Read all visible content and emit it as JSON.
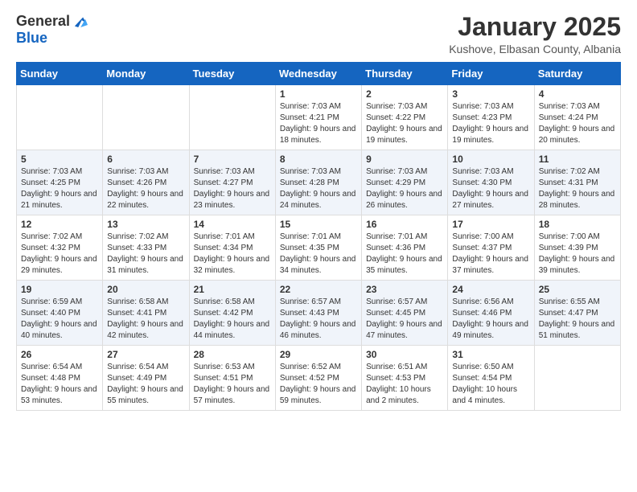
{
  "header": {
    "logo_general": "General",
    "logo_blue": "Blue",
    "month_title": "January 2025",
    "subtitle": "Kushove, Elbasan County, Albania"
  },
  "weekdays": [
    "Sunday",
    "Monday",
    "Tuesday",
    "Wednesday",
    "Thursday",
    "Friday",
    "Saturday"
  ],
  "weeks": [
    [
      {
        "day": "",
        "sunrise": "",
        "sunset": "",
        "daylight": ""
      },
      {
        "day": "",
        "sunrise": "",
        "sunset": "",
        "daylight": ""
      },
      {
        "day": "",
        "sunrise": "",
        "sunset": "",
        "daylight": ""
      },
      {
        "day": "1",
        "sunrise": "Sunrise: 7:03 AM",
        "sunset": "Sunset: 4:21 PM",
        "daylight": "Daylight: 9 hours and 18 minutes."
      },
      {
        "day": "2",
        "sunrise": "Sunrise: 7:03 AM",
        "sunset": "Sunset: 4:22 PM",
        "daylight": "Daylight: 9 hours and 19 minutes."
      },
      {
        "day": "3",
        "sunrise": "Sunrise: 7:03 AM",
        "sunset": "Sunset: 4:23 PM",
        "daylight": "Daylight: 9 hours and 19 minutes."
      },
      {
        "day": "4",
        "sunrise": "Sunrise: 7:03 AM",
        "sunset": "Sunset: 4:24 PM",
        "daylight": "Daylight: 9 hours and 20 minutes."
      }
    ],
    [
      {
        "day": "5",
        "sunrise": "Sunrise: 7:03 AM",
        "sunset": "Sunset: 4:25 PM",
        "daylight": "Daylight: 9 hours and 21 minutes."
      },
      {
        "day": "6",
        "sunrise": "Sunrise: 7:03 AM",
        "sunset": "Sunset: 4:26 PM",
        "daylight": "Daylight: 9 hours and 22 minutes."
      },
      {
        "day": "7",
        "sunrise": "Sunrise: 7:03 AM",
        "sunset": "Sunset: 4:27 PM",
        "daylight": "Daylight: 9 hours and 23 minutes."
      },
      {
        "day": "8",
        "sunrise": "Sunrise: 7:03 AM",
        "sunset": "Sunset: 4:28 PM",
        "daylight": "Daylight: 9 hours and 24 minutes."
      },
      {
        "day": "9",
        "sunrise": "Sunrise: 7:03 AM",
        "sunset": "Sunset: 4:29 PM",
        "daylight": "Daylight: 9 hours and 26 minutes."
      },
      {
        "day": "10",
        "sunrise": "Sunrise: 7:03 AM",
        "sunset": "Sunset: 4:30 PM",
        "daylight": "Daylight: 9 hours and 27 minutes."
      },
      {
        "day": "11",
        "sunrise": "Sunrise: 7:02 AM",
        "sunset": "Sunset: 4:31 PM",
        "daylight": "Daylight: 9 hours and 28 minutes."
      }
    ],
    [
      {
        "day": "12",
        "sunrise": "Sunrise: 7:02 AM",
        "sunset": "Sunset: 4:32 PM",
        "daylight": "Daylight: 9 hours and 29 minutes."
      },
      {
        "day": "13",
        "sunrise": "Sunrise: 7:02 AM",
        "sunset": "Sunset: 4:33 PM",
        "daylight": "Daylight: 9 hours and 31 minutes."
      },
      {
        "day": "14",
        "sunrise": "Sunrise: 7:01 AM",
        "sunset": "Sunset: 4:34 PM",
        "daylight": "Daylight: 9 hours and 32 minutes."
      },
      {
        "day": "15",
        "sunrise": "Sunrise: 7:01 AM",
        "sunset": "Sunset: 4:35 PM",
        "daylight": "Daylight: 9 hours and 34 minutes."
      },
      {
        "day": "16",
        "sunrise": "Sunrise: 7:01 AM",
        "sunset": "Sunset: 4:36 PM",
        "daylight": "Daylight: 9 hours and 35 minutes."
      },
      {
        "day": "17",
        "sunrise": "Sunrise: 7:00 AM",
        "sunset": "Sunset: 4:37 PM",
        "daylight": "Daylight: 9 hours and 37 minutes."
      },
      {
        "day": "18",
        "sunrise": "Sunrise: 7:00 AM",
        "sunset": "Sunset: 4:39 PM",
        "daylight": "Daylight: 9 hours and 39 minutes."
      }
    ],
    [
      {
        "day": "19",
        "sunrise": "Sunrise: 6:59 AM",
        "sunset": "Sunset: 4:40 PM",
        "daylight": "Daylight: 9 hours and 40 minutes."
      },
      {
        "day": "20",
        "sunrise": "Sunrise: 6:58 AM",
        "sunset": "Sunset: 4:41 PM",
        "daylight": "Daylight: 9 hours and 42 minutes."
      },
      {
        "day": "21",
        "sunrise": "Sunrise: 6:58 AM",
        "sunset": "Sunset: 4:42 PM",
        "daylight": "Daylight: 9 hours and 44 minutes."
      },
      {
        "day": "22",
        "sunrise": "Sunrise: 6:57 AM",
        "sunset": "Sunset: 4:43 PM",
        "daylight": "Daylight: 9 hours and 46 minutes."
      },
      {
        "day": "23",
        "sunrise": "Sunrise: 6:57 AM",
        "sunset": "Sunset: 4:45 PM",
        "daylight": "Daylight: 9 hours and 47 minutes."
      },
      {
        "day": "24",
        "sunrise": "Sunrise: 6:56 AM",
        "sunset": "Sunset: 4:46 PM",
        "daylight": "Daylight: 9 hours and 49 minutes."
      },
      {
        "day": "25",
        "sunrise": "Sunrise: 6:55 AM",
        "sunset": "Sunset: 4:47 PM",
        "daylight": "Daylight: 9 hours and 51 minutes."
      }
    ],
    [
      {
        "day": "26",
        "sunrise": "Sunrise: 6:54 AM",
        "sunset": "Sunset: 4:48 PM",
        "daylight": "Daylight: 9 hours and 53 minutes."
      },
      {
        "day": "27",
        "sunrise": "Sunrise: 6:54 AM",
        "sunset": "Sunset: 4:49 PM",
        "daylight": "Daylight: 9 hours and 55 minutes."
      },
      {
        "day": "28",
        "sunrise": "Sunrise: 6:53 AM",
        "sunset": "Sunset: 4:51 PM",
        "daylight": "Daylight: 9 hours and 57 minutes."
      },
      {
        "day": "29",
        "sunrise": "Sunrise: 6:52 AM",
        "sunset": "Sunset: 4:52 PM",
        "daylight": "Daylight: 9 hours and 59 minutes."
      },
      {
        "day": "30",
        "sunrise": "Sunrise: 6:51 AM",
        "sunset": "Sunset: 4:53 PM",
        "daylight": "Daylight: 10 hours and 2 minutes."
      },
      {
        "day": "31",
        "sunrise": "Sunrise: 6:50 AM",
        "sunset": "Sunset: 4:54 PM",
        "daylight": "Daylight: 10 hours and 4 minutes."
      },
      {
        "day": "",
        "sunrise": "",
        "sunset": "",
        "daylight": ""
      }
    ]
  ]
}
